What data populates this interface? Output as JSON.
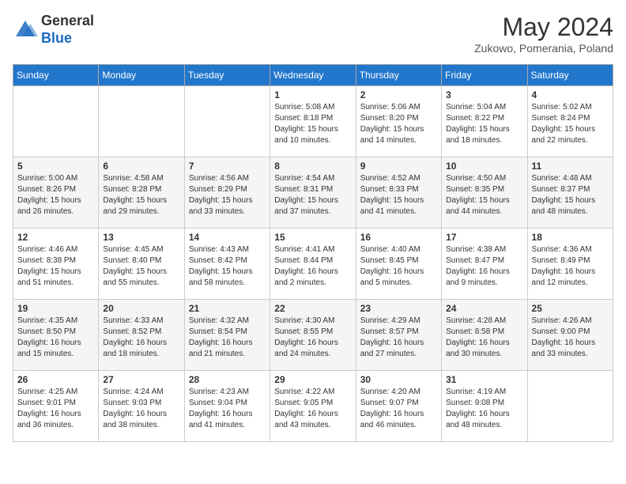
{
  "header": {
    "logo_general": "General",
    "logo_blue": "Blue",
    "month_year": "May 2024",
    "location": "Zukowo, Pomerania, Poland"
  },
  "weekdays": [
    "Sunday",
    "Monday",
    "Tuesday",
    "Wednesday",
    "Thursday",
    "Friday",
    "Saturday"
  ],
  "weeks": [
    [
      {
        "day": "",
        "info": ""
      },
      {
        "day": "",
        "info": ""
      },
      {
        "day": "",
        "info": ""
      },
      {
        "day": "1",
        "info": "Sunrise: 5:08 AM\nSunset: 8:18 PM\nDaylight: 15 hours\nand 10 minutes."
      },
      {
        "day": "2",
        "info": "Sunrise: 5:06 AM\nSunset: 8:20 PM\nDaylight: 15 hours\nand 14 minutes."
      },
      {
        "day": "3",
        "info": "Sunrise: 5:04 AM\nSunset: 8:22 PM\nDaylight: 15 hours\nand 18 minutes."
      },
      {
        "day": "4",
        "info": "Sunrise: 5:02 AM\nSunset: 8:24 PM\nDaylight: 15 hours\nand 22 minutes."
      }
    ],
    [
      {
        "day": "5",
        "info": "Sunrise: 5:00 AM\nSunset: 8:26 PM\nDaylight: 15 hours\nand 26 minutes."
      },
      {
        "day": "6",
        "info": "Sunrise: 4:58 AM\nSunset: 8:28 PM\nDaylight: 15 hours\nand 29 minutes."
      },
      {
        "day": "7",
        "info": "Sunrise: 4:56 AM\nSunset: 8:29 PM\nDaylight: 15 hours\nand 33 minutes."
      },
      {
        "day": "8",
        "info": "Sunrise: 4:54 AM\nSunset: 8:31 PM\nDaylight: 15 hours\nand 37 minutes."
      },
      {
        "day": "9",
        "info": "Sunrise: 4:52 AM\nSunset: 8:33 PM\nDaylight: 15 hours\nand 41 minutes."
      },
      {
        "day": "10",
        "info": "Sunrise: 4:50 AM\nSunset: 8:35 PM\nDaylight: 15 hours\nand 44 minutes."
      },
      {
        "day": "11",
        "info": "Sunrise: 4:48 AM\nSunset: 8:37 PM\nDaylight: 15 hours\nand 48 minutes."
      }
    ],
    [
      {
        "day": "12",
        "info": "Sunrise: 4:46 AM\nSunset: 8:38 PM\nDaylight: 15 hours\nand 51 minutes."
      },
      {
        "day": "13",
        "info": "Sunrise: 4:45 AM\nSunset: 8:40 PM\nDaylight: 15 hours\nand 55 minutes."
      },
      {
        "day": "14",
        "info": "Sunrise: 4:43 AM\nSunset: 8:42 PM\nDaylight: 15 hours\nand 58 minutes."
      },
      {
        "day": "15",
        "info": "Sunrise: 4:41 AM\nSunset: 8:44 PM\nDaylight: 16 hours\nand 2 minutes."
      },
      {
        "day": "16",
        "info": "Sunrise: 4:40 AM\nSunset: 8:45 PM\nDaylight: 16 hours\nand 5 minutes."
      },
      {
        "day": "17",
        "info": "Sunrise: 4:38 AM\nSunset: 8:47 PM\nDaylight: 16 hours\nand 9 minutes."
      },
      {
        "day": "18",
        "info": "Sunrise: 4:36 AM\nSunset: 8:49 PM\nDaylight: 16 hours\nand 12 minutes."
      }
    ],
    [
      {
        "day": "19",
        "info": "Sunrise: 4:35 AM\nSunset: 8:50 PM\nDaylight: 16 hours\nand 15 minutes."
      },
      {
        "day": "20",
        "info": "Sunrise: 4:33 AM\nSunset: 8:52 PM\nDaylight: 16 hours\nand 18 minutes."
      },
      {
        "day": "21",
        "info": "Sunrise: 4:32 AM\nSunset: 8:54 PM\nDaylight: 16 hours\nand 21 minutes."
      },
      {
        "day": "22",
        "info": "Sunrise: 4:30 AM\nSunset: 8:55 PM\nDaylight: 16 hours\nand 24 minutes."
      },
      {
        "day": "23",
        "info": "Sunrise: 4:29 AM\nSunset: 8:57 PM\nDaylight: 16 hours\nand 27 minutes."
      },
      {
        "day": "24",
        "info": "Sunrise: 4:28 AM\nSunset: 8:58 PM\nDaylight: 16 hours\nand 30 minutes."
      },
      {
        "day": "25",
        "info": "Sunrise: 4:26 AM\nSunset: 9:00 PM\nDaylight: 16 hours\nand 33 minutes."
      }
    ],
    [
      {
        "day": "26",
        "info": "Sunrise: 4:25 AM\nSunset: 9:01 PM\nDaylight: 16 hours\nand 36 minutes."
      },
      {
        "day": "27",
        "info": "Sunrise: 4:24 AM\nSunset: 9:03 PM\nDaylight: 16 hours\nand 38 minutes."
      },
      {
        "day": "28",
        "info": "Sunrise: 4:23 AM\nSunset: 9:04 PM\nDaylight: 16 hours\nand 41 minutes."
      },
      {
        "day": "29",
        "info": "Sunrise: 4:22 AM\nSunset: 9:05 PM\nDaylight: 16 hours\nand 43 minutes."
      },
      {
        "day": "30",
        "info": "Sunrise: 4:20 AM\nSunset: 9:07 PM\nDaylight: 16 hours\nand 46 minutes."
      },
      {
        "day": "31",
        "info": "Sunrise: 4:19 AM\nSunset: 9:08 PM\nDaylight: 16 hours\nand 48 minutes."
      },
      {
        "day": "",
        "info": ""
      }
    ]
  ]
}
